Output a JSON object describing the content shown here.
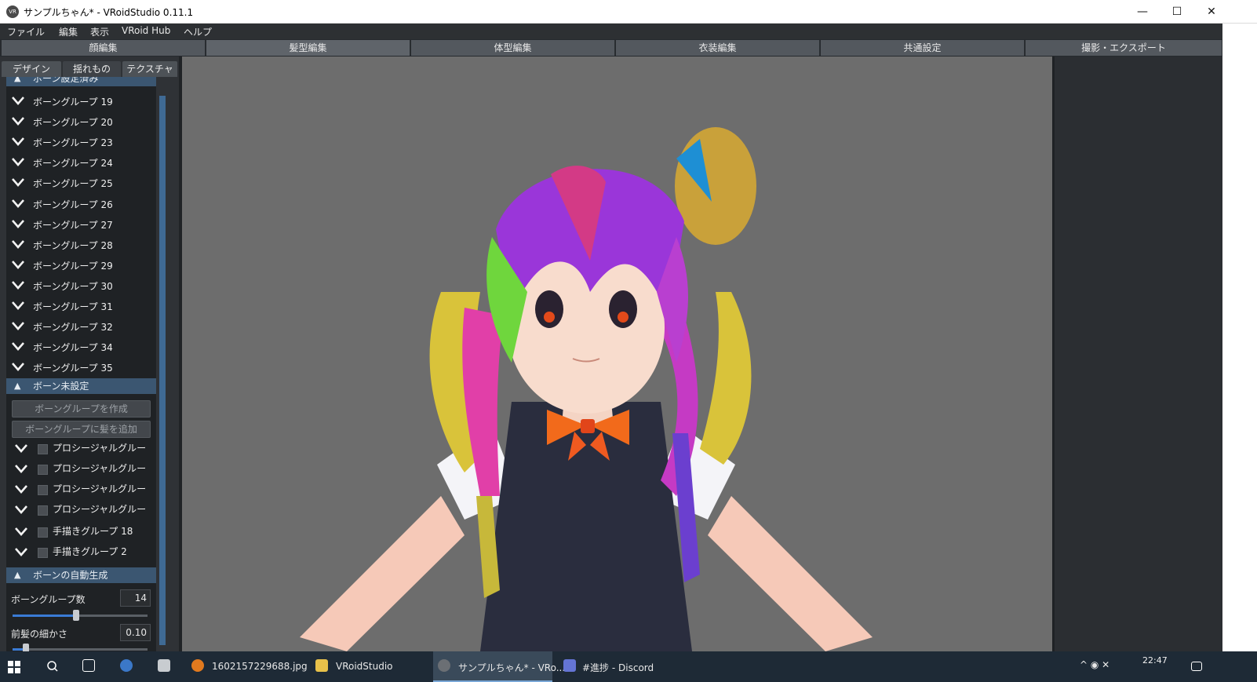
{
  "window": {
    "icon_text": "VR",
    "title": "サンプルちゃん* - VRoidStudio 0.11.1",
    "controls": {
      "minimize": "—",
      "maximize": "☐",
      "close": "✕"
    }
  },
  "menu": [
    "ファイル",
    "編集",
    "表示",
    "VRoid Hub",
    "ヘルプ"
  ],
  "main_tabs": [
    "顔編集",
    "髪型編集",
    "体型編集",
    "衣装編集",
    "共通設定",
    "撮影・エクスポート"
  ],
  "sub_tabs": [
    "デザイン",
    "揺れもの",
    "テクスチャ"
  ],
  "sections": {
    "bones_set": "ボーン設定済み",
    "bones_unset": "ボーン未設定",
    "auto_gen": "ボーンの自動生成"
  },
  "bone_groups_set": [
    "ボーングループ 19",
    "ボーングループ 20",
    "ボーングループ 23",
    "ボーングループ 24",
    "ボーングループ 25",
    "ボーングループ 26",
    "ボーングループ 27",
    "ボーングループ 28",
    "ボーングループ 29",
    "ボーングループ 30",
    "ボーングループ 31",
    "ボーングループ 32",
    "ボーングループ 34",
    "ボーングループ 35"
  ],
  "unset_buttons": {
    "create": "ボーングループを作成",
    "add_hair": "ボーングループに髪を追加"
  },
  "bone_groups_unset": [
    "プロシージャルグルー",
    "プロシージャルグルー",
    "プロシージャルグルー",
    "プロシージャルグルー",
    "手描きグループ 18",
    "手描きグループ 2"
  ],
  "params": [
    {
      "label": "ボーングループ数",
      "value": "14",
      "level": 0.47
    },
    {
      "label": "前髪の細かさ",
      "value": "0.10",
      "level": 0.1
    }
  ],
  "taskbar": {
    "items": [
      "1602157229688.jpg",
      "VRoidStudio",
      "サンプルちゃん* - VRo...",
      "#進捗 - Discord"
    ],
    "clock": "22:47"
  }
}
